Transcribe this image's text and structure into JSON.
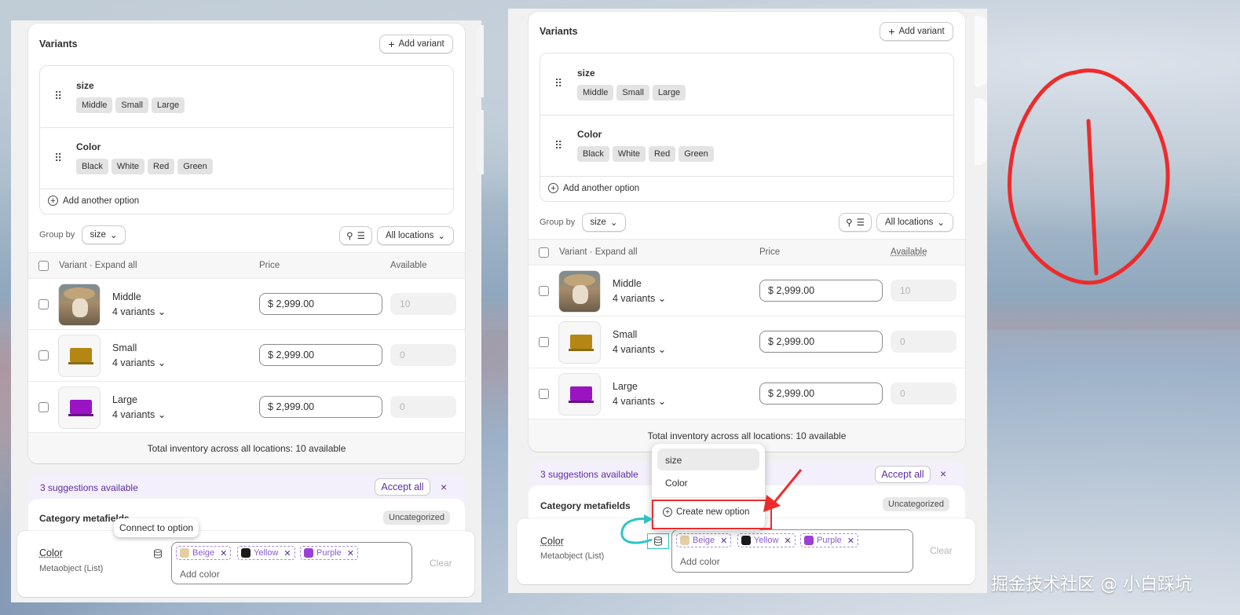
{
  "left": {
    "variants_title": "Variants",
    "add_variant": "Add variant",
    "options": [
      {
        "name": "size",
        "values": [
          "Middle",
          "Small",
          "Large"
        ]
      },
      {
        "name": "Color",
        "values": [
          "Black",
          "White",
          "Red",
          "Green"
        ]
      }
    ],
    "add_another_option": "Add another option",
    "group_by_label": "Group by",
    "group_by_value": "size",
    "locations": "All locations",
    "col_variant": "Variant · Expand all",
    "col_price": "Price",
    "col_available": "Available",
    "rows": [
      {
        "name": "Middle",
        "sub": "4 variants",
        "price": "2,999.00",
        "available": "10"
      },
      {
        "name": "Small",
        "sub": "4 variants",
        "price": "2,999.00",
        "available": "0"
      },
      {
        "name": "Large",
        "sub": "4 variants",
        "price": "2,999.00",
        "available": "0"
      }
    ],
    "currency": "$",
    "total": "Total inventory across all locations: 10 available",
    "suggestions": "3 suggestions available",
    "accept_all": "Accept all",
    "close": "×",
    "category_metafields": "Category metafields",
    "uncategorized": "Uncategorized",
    "tooltip": "Connect to option",
    "field_name": "Color",
    "field_type": "Metaobject (List)",
    "chips": [
      {
        "label": "Beige",
        "color": "#e5cfa2"
      },
      {
        "label": "Yellow",
        "color": "#1a1a1a"
      },
      {
        "label": "Purple",
        "color": "#9b3fd6"
      }
    ],
    "add_color": "Add color",
    "clear": "Clear"
  },
  "right": {
    "variants_title": "Variants",
    "add_variant": "Add variant",
    "options": [
      {
        "name": "size",
        "values": [
          "Middle",
          "Small",
          "Large"
        ]
      },
      {
        "name": "Color",
        "values": [
          "Black",
          "White",
          "Red",
          "Green"
        ]
      }
    ],
    "add_another_option": "Add another option",
    "group_by_label": "Group by",
    "group_by_value": "size",
    "locations": "All locations",
    "col_variant": "Variant · Expand all",
    "col_price": "Price",
    "col_available": "Available",
    "rows": [
      {
        "name": "Middle",
        "sub": "4 variants",
        "price": "2,999.00",
        "available": "10"
      },
      {
        "name": "Small",
        "sub": "4 variants",
        "price": "2,999.00",
        "available": "0"
      },
      {
        "name": "Large",
        "sub": "4 variants",
        "price": "2,999.00",
        "available": "0"
      }
    ],
    "currency": "$",
    "total": "Total inventory across all locations: 10 available",
    "suggestions": "3 suggestions available",
    "accept_all": "Accept all",
    "close": "×",
    "category_metafields": "Category metafields",
    "uncategorized": "Uncategorized",
    "menu_items": [
      "size",
      "Color"
    ],
    "create_new_option": "Create new option",
    "field_name": "Color",
    "field_type": "Metaobject (List)",
    "chips": [
      {
        "label": "Beige",
        "color": "#e5cfa2"
      },
      {
        "label": "Yellow",
        "color": "#1a1a1a"
      },
      {
        "label": "Purple",
        "color": "#9b3fd6"
      }
    ],
    "add_color": "Add color",
    "clear": "Clear"
  },
  "watermark": "掘金技术社区 @ 小白踩坑",
  "icons": [
    "plus-icon",
    "drag-handle-icon",
    "plus-circle-icon",
    "search-icon",
    "filter-icon",
    "chevron-down-icon",
    "close-icon",
    "database-icon"
  ],
  "annotation_colors": {
    "red": "#ee2b2b",
    "cyan": "#2ec4c4"
  }
}
